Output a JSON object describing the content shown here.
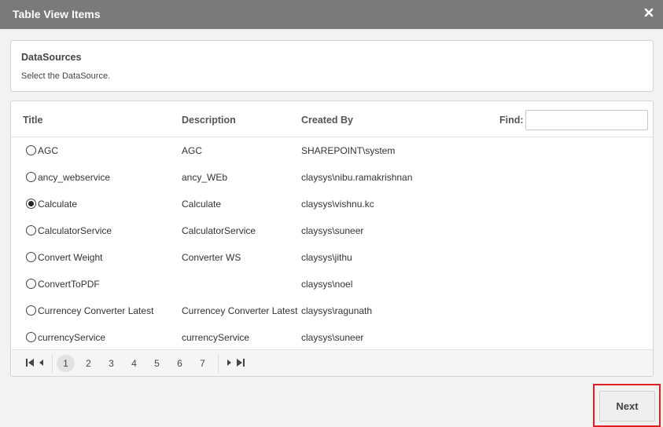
{
  "dialog": {
    "title": "Table View Items",
    "close_icon": "close-icon"
  },
  "info": {
    "heading": "DataSources",
    "subtext": "Select the DataSource."
  },
  "grid": {
    "columns": {
      "title": "Title",
      "description": "Description",
      "created_by": "Created By"
    },
    "find": {
      "label": "Find:",
      "value": "",
      "placeholder": ""
    },
    "rows": [
      {
        "title": "AGC",
        "description": "AGC",
        "created_by": "SHAREPOINT\\system",
        "selected": false
      },
      {
        "title": "ancy_webservice",
        "description": "ancy_WEb",
        "created_by": "claysys\\nibu.ramakrishnan",
        "selected": false
      },
      {
        "title": "Calculate",
        "description": "Calculate",
        "created_by": "claysys\\vishnu.kc",
        "selected": true
      },
      {
        "title": "CalculatorService",
        "description": "CalculatorService",
        "created_by": "claysys\\suneer",
        "selected": false
      },
      {
        "title": "Convert Weight",
        "description": "Converter WS",
        "created_by": "claysys\\jithu",
        "selected": false
      },
      {
        "title": "ConvertToPDF",
        "description": "",
        "created_by": "claysys\\noel",
        "selected": false
      },
      {
        "title": "Currencey Converter Latest",
        "description": "Currencey Converter Latest",
        "created_by": "claysys\\ragunath",
        "selected": false
      },
      {
        "title": "currencyService",
        "description": "currencyService",
        "created_by": "claysys\\suneer",
        "selected": false
      }
    ]
  },
  "pager": {
    "pages": [
      "1",
      "2",
      "3",
      "4",
      "5",
      "6",
      "7"
    ],
    "current": "1"
  },
  "actions": {
    "next_label": "Next"
  },
  "colors": {
    "titlebar": "#7a7a7a",
    "highlight": "#e0201e"
  }
}
